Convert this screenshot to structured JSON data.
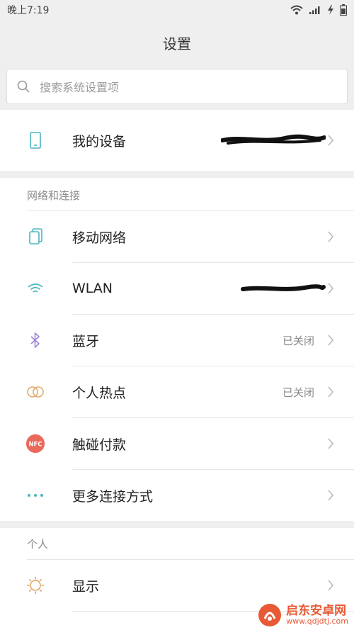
{
  "status_bar": {
    "time": "晚上7:19"
  },
  "header": {
    "title": "设置"
  },
  "search": {
    "placeholder": "搜索系统设置项"
  },
  "device_row": {
    "label": "我的设备"
  },
  "network_section": {
    "title": "网络和连接",
    "items": [
      {
        "label": "移动网络",
        "value": "",
        "icon": "sim-card-icon"
      },
      {
        "label": "WLAN",
        "value": "",
        "icon": "wifi-icon"
      },
      {
        "label": "蓝牙",
        "value": "已关闭",
        "icon": "bluetooth-icon"
      },
      {
        "label": "个人热点",
        "value": "已关闭",
        "icon": "hotspot-icon"
      },
      {
        "label": "触碰付款",
        "value": "",
        "icon": "nfc-icon",
        "icon_text": "NFC"
      },
      {
        "label": "更多连接方式",
        "value": "",
        "icon": "more-dots-icon"
      }
    ]
  },
  "personal_section": {
    "title": "个人",
    "items": [
      {
        "label": "显示",
        "icon": "brightness-icon"
      }
    ]
  },
  "watermark": {
    "cn": "启东安卓网",
    "en": "www.qdjdtj.com"
  },
  "colors": {
    "background": "#efefef",
    "nfc_red": "#e86a5a",
    "teal": "#4bb5c1",
    "watermark_orange": "#e85a35"
  }
}
